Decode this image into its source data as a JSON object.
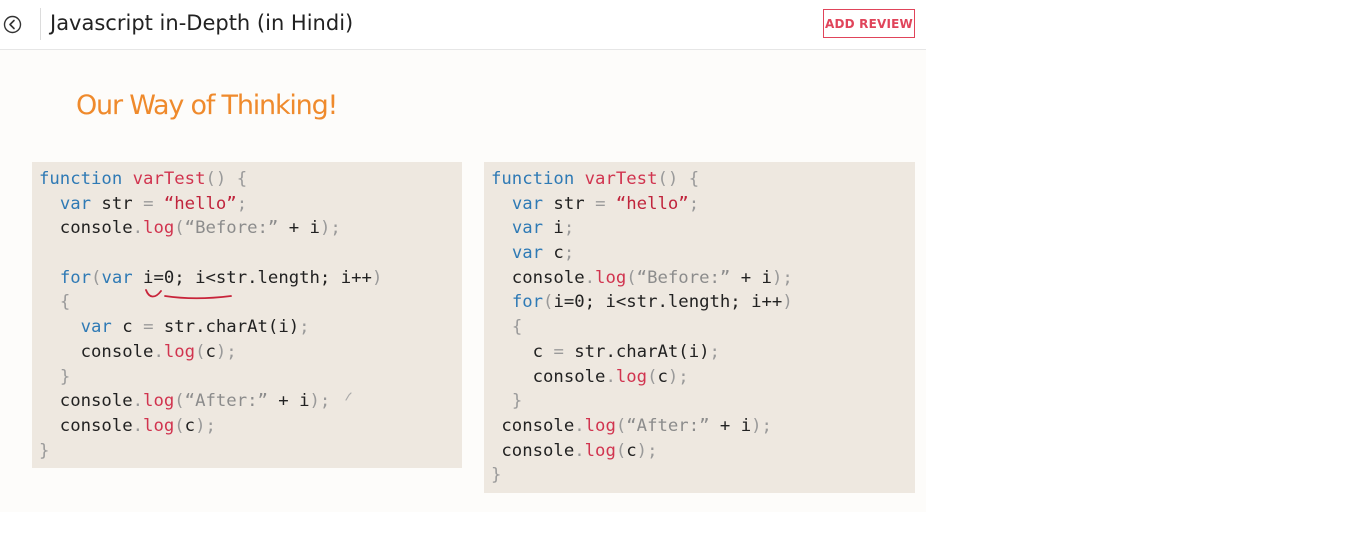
{
  "header": {
    "back_icon": "chevron-left-circle-icon",
    "title": "Javascript in-Depth (in Hindi)",
    "add_review_label": "ADD REVIEW",
    "accent_color": "#e0445a"
  },
  "slide": {
    "heading": "Our Way of Thinking!",
    "heading_color": "#ef8a2c",
    "code_bg_color": "#eee8e0",
    "left_code": [
      "function varTest() {",
      "  var str = “hello”;",
      "  console.log(“Before:” + i);",
      "",
      "  for(var i=0; i<str.length; i++)",
      "  {",
      "    var c = str.charAt(i);",
      "    console.log(c);",
      "  }",
      "  console.log(“After:” + i);",
      "  console.log(c);",
      "}"
    ],
    "right_code": [
      "function varTest() {",
      "  var str = “hello”;",
      "  var i;",
      "  var c;",
      "  console.log(“Before:” + i);",
      "  for(i=0; i<str.length; i++)",
      "  {",
      "    c = str.charAt(i);",
      "    console.log(c);",
      "  }",
      " console.log(“After:” + i);",
      " console.log(c);",
      "}"
    ]
  }
}
